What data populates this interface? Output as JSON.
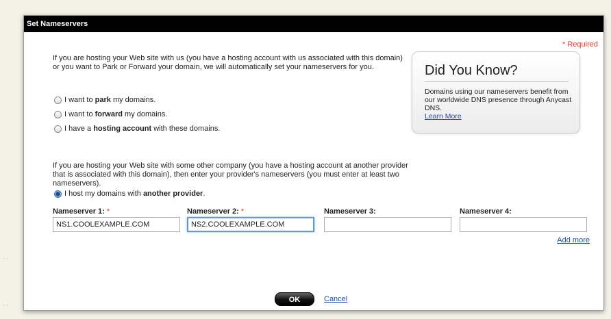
{
  "dialog": {
    "title": "Set Nameservers",
    "required_note": "* Required",
    "intro_text": "If you are hosting your Web site with us (you have a hosting account with us associated with this domain) or you want to Park or Forward your domain, we will automatically set your nameservers for you.",
    "options": [
      {
        "pre": "I want to ",
        "bold": "park",
        "post": " my domains.",
        "selected": false
      },
      {
        "pre": "I want to ",
        "bold": "forward",
        "post": " my domains.",
        "selected": false
      },
      {
        "pre": "I have a ",
        "bold": "hosting account",
        "post": " with these domains.",
        "selected": false
      }
    ],
    "intro2_text": "If you are hosting your Web site with some other company (you have a hosting account at another provider that is associated with this domain), then enter your provider's nameservers (you must enter at least two nameservers).",
    "custom_option": {
      "pre": "I host my domains with ",
      "bold": "another provider",
      "post": ".",
      "selected": true
    },
    "nameservers": [
      {
        "label": "Nameserver 1:",
        "required_mark": "*",
        "value": "NS1.COOLEXAMPLE.COM"
      },
      {
        "label": "Nameserver 2:",
        "required_mark": "*",
        "value": "NS2.COOLEXAMPLE.COM"
      },
      {
        "label": "Nameserver 3:",
        "required_mark": "",
        "value": ""
      },
      {
        "label": "Nameserver 4:",
        "required_mark": "",
        "value": ""
      }
    ],
    "add_more": "Add more",
    "ok_label": "OK",
    "cancel_label": "Cancel"
  },
  "did_you_know": {
    "title": "Did You Know?",
    "body": "Domains using our nameservers benefit from our worldwide DNS presence through Anycast DNS.",
    "link": "Learn More"
  }
}
